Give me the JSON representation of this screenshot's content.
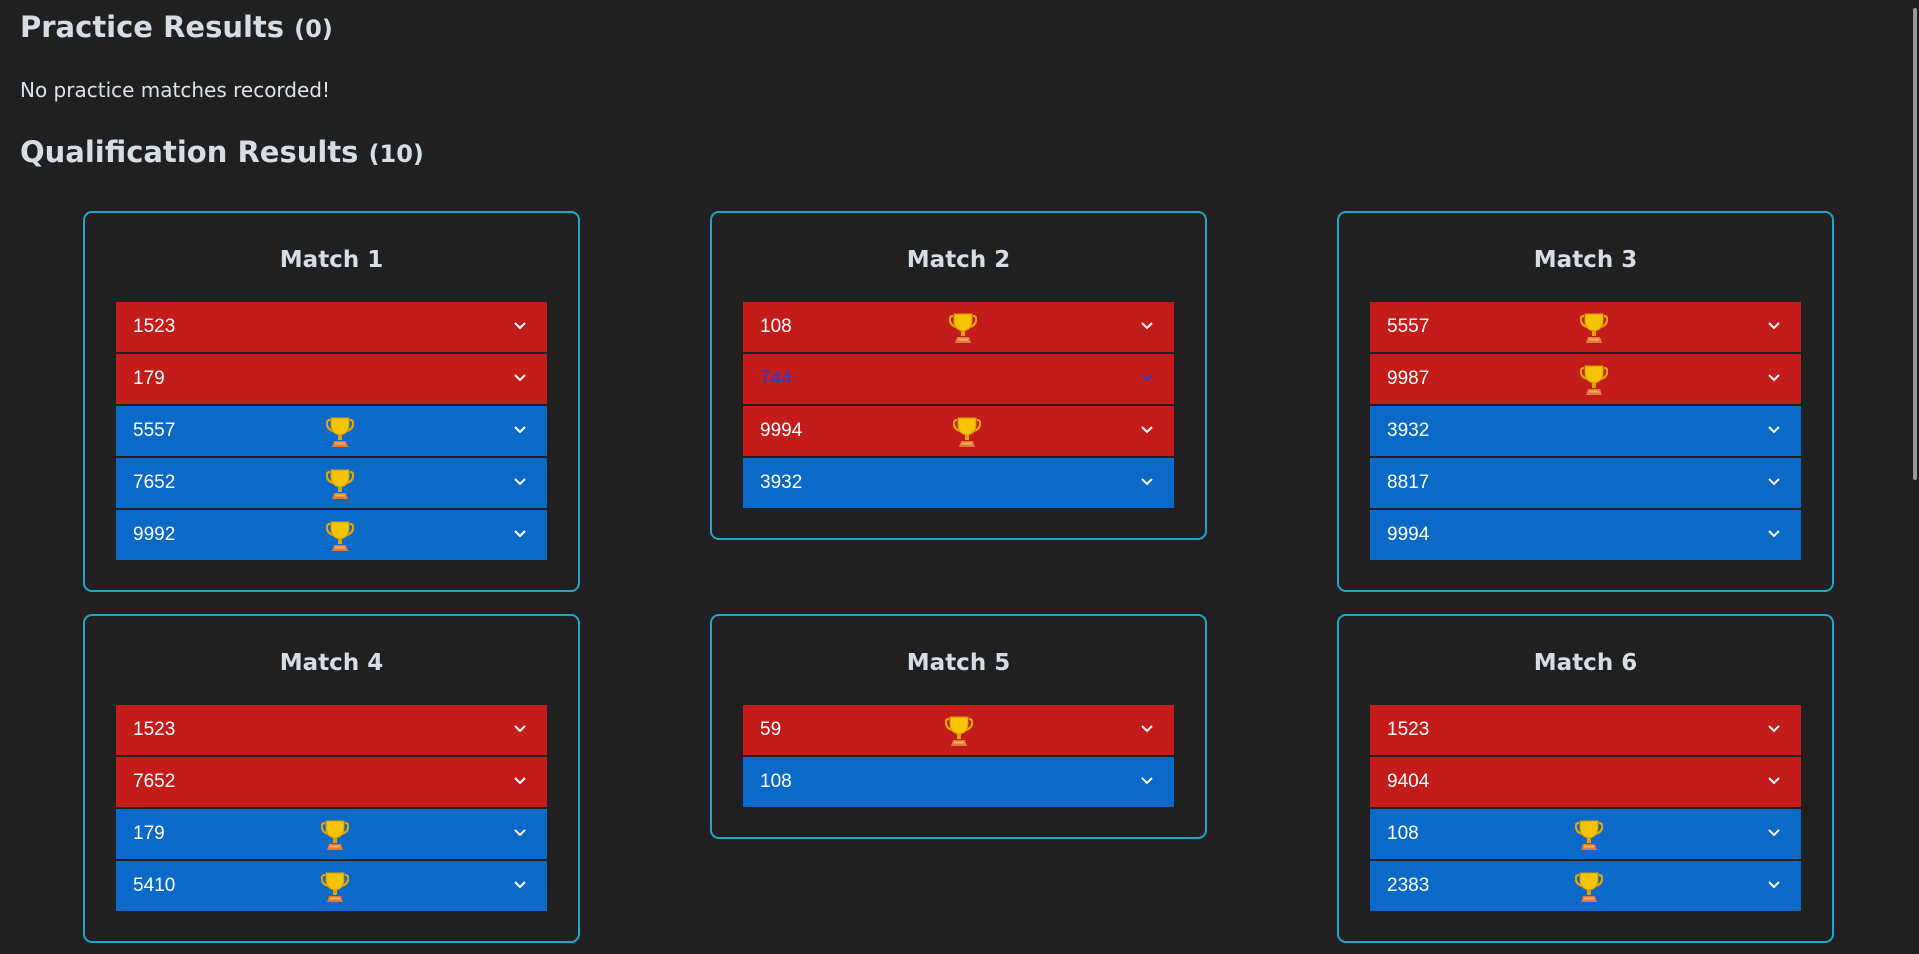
{
  "practice": {
    "title": "Practice Results",
    "count": "(0)",
    "empty_text": "No practice matches recorded!"
  },
  "qualification": {
    "title": "Qualification Results",
    "count": "(10)"
  },
  "colors": {
    "red": "#c41b1b",
    "blue": "#0b69c8",
    "card_border": "#1fa6c9",
    "background": "#202020"
  },
  "matches": [
    {
      "title": "Match 1",
      "teams": [
        {
          "number": "1523",
          "alliance": "red",
          "winner": false
        },
        {
          "number": "179",
          "alliance": "red",
          "winner": false
        },
        {
          "number": "5557",
          "alliance": "blue",
          "winner": true
        },
        {
          "number": "7652",
          "alliance": "blue",
          "winner": true
        },
        {
          "number": "9992",
          "alliance": "blue",
          "winner": true
        }
      ]
    },
    {
      "title": "Match 2",
      "teams": [
        {
          "number": "108",
          "alliance": "red",
          "winner": true
        },
        {
          "number": "744",
          "alliance": "red",
          "winner": false,
          "hovered": true
        },
        {
          "number": "9994",
          "alliance": "red",
          "winner": true
        },
        {
          "number": "3932",
          "alliance": "blue",
          "winner": false
        }
      ]
    },
    {
      "title": "Match 3",
      "teams": [
        {
          "number": "5557",
          "alliance": "red",
          "winner": true
        },
        {
          "number": "9987",
          "alliance": "red",
          "winner": true
        },
        {
          "number": "3932",
          "alliance": "blue",
          "winner": false
        },
        {
          "number": "8817",
          "alliance": "blue",
          "winner": false
        },
        {
          "number": "9994",
          "alliance": "blue",
          "winner": false
        }
      ]
    },
    {
      "title": "Match 4",
      "teams": [
        {
          "number": "1523",
          "alliance": "red",
          "winner": false
        },
        {
          "number": "7652",
          "alliance": "red",
          "winner": false
        },
        {
          "number": "179",
          "alliance": "blue",
          "winner": true
        },
        {
          "number": "5410",
          "alliance": "blue",
          "winner": true
        }
      ]
    },
    {
      "title": "Match 5",
      "teams": [
        {
          "number": "59",
          "alliance": "red",
          "winner": true
        },
        {
          "number": "108",
          "alliance": "blue",
          "winner": false
        }
      ]
    },
    {
      "title": "Match 6",
      "teams": [
        {
          "number": "1523",
          "alliance": "red",
          "winner": false
        },
        {
          "number": "9404",
          "alliance": "red",
          "winner": false
        },
        {
          "number": "108",
          "alliance": "blue",
          "winner": true
        },
        {
          "number": "2383",
          "alliance": "blue",
          "winner": true
        }
      ]
    }
  ],
  "icons": {
    "winner": "trophy-icon",
    "expand": "chevron-down-icon"
  }
}
